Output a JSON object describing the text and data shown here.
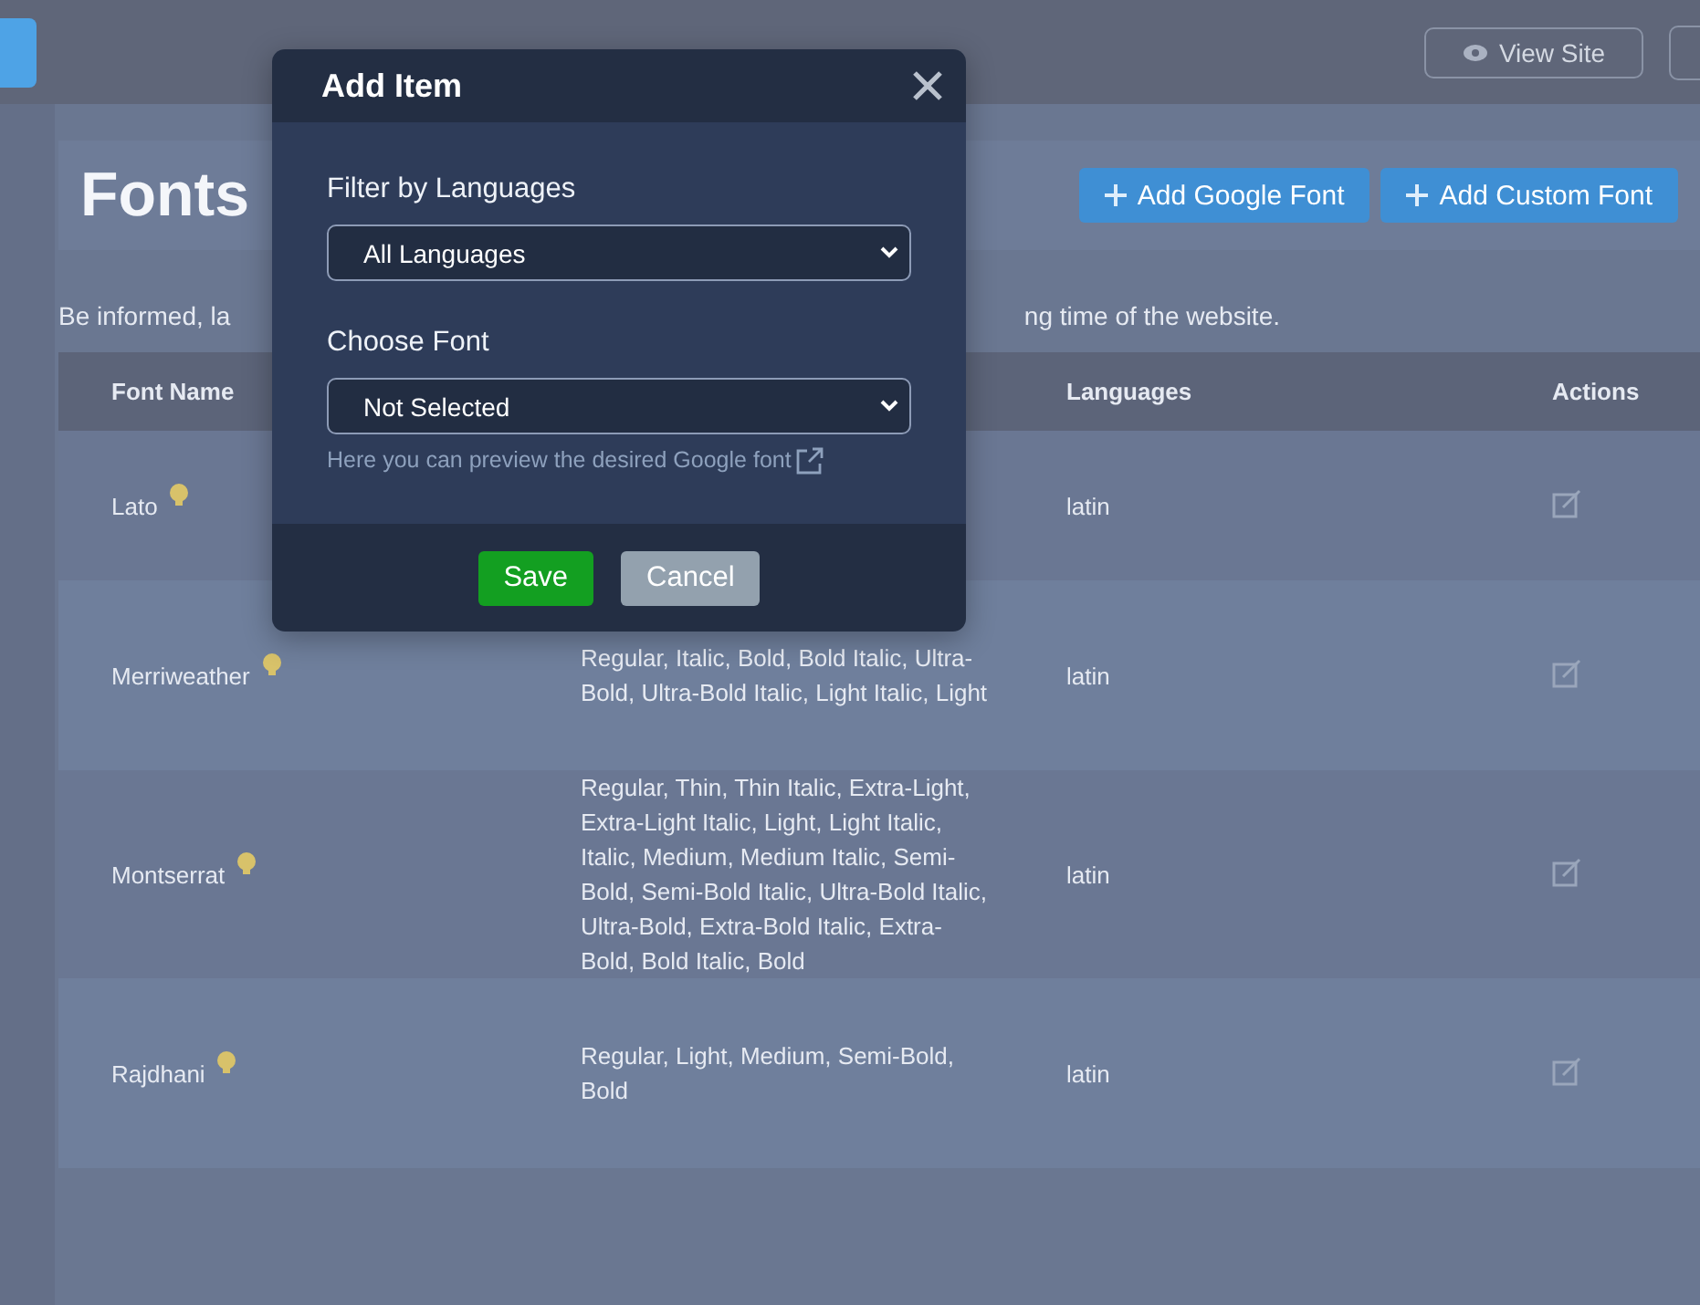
{
  "topbar": {
    "view_site": "View Site"
  },
  "page": {
    "title": "Fonts",
    "buttons": [
      "Add Google Font",
      "Add Custom Font"
    ],
    "notice_left": "Be informed, la",
    "notice_right": "ng time of the website."
  },
  "table": {
    "headers": {
      "font_name": "Font Name",
      "languages": "Languages",
      "actions": "Actions"
    },
    "rows": [
      {
        "name": "Lato",
        "languages": "latin"
      },
      {
        "name": "Merriweather",
        "styles": "Regular, Italic, Bold, Bold Italic, Ultra-Bold, Ultra-Bold Italic, Light Italic, Light",
        "languages": "latin"
      },
      {
        "name": "Montserrat",
        "styles": "Regular, Thin, Thin Italic, Extra-Light, Extra-Light Italic, Light, Light Italic, Italic, Medium, Medium Italic, Semi-Bold, Semi-Bold Italic, Ultra-Bold Italic, Ultra-Bold, Extra-Bold Italic, Extra-Bold, Bold Italic, Bold",
        "languages": "latin"
      },
      {
        "name": "Rajdhani",
        "styles": "Regular, Light, Medium, Semi-Bold, Bold",
        "languages": "latin"
      }
    ]
  },
  "dialog": {
    "title": "Add Item",
    "fields": [
      {
        "label": "Filter by Languages",
        "value": "All Languages"
      },
      {
        "label": "Choose Font",
        "value": "Not Selected",
        "hint": "Here you can preview the desired Google font"
      }
    ],
    "buttons": [
      {
        "label": "Save",
        "kind": "primary"
      },
      {
        "label": "Cancel",
        "kind": "secondary"
      }
    ]
  }
}
